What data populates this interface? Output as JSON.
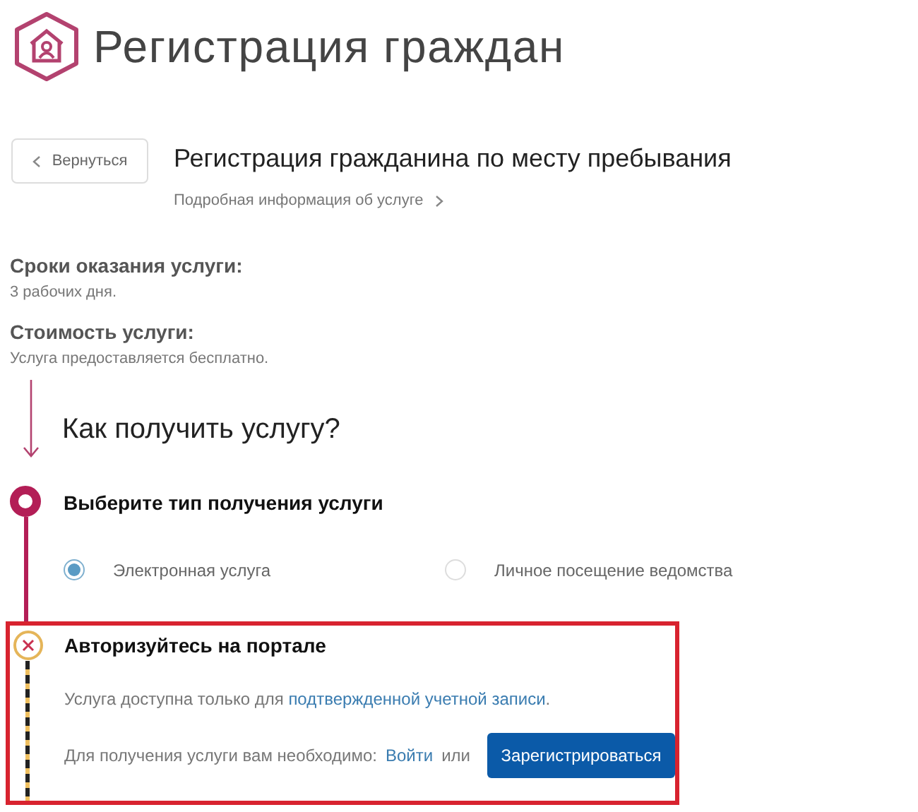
{
  "page_title": "Регистрация граждан",
  "back_button": "Вернуться",
  "service": {
    "title": "Регистрация гражданина по месту пребывания",
    "details_link": "Подробная информация об услуге"
  },
  "info": [
    {
      "label": "Сроки оказания услуги:",
      "value": "3 рабочих дня."
    },
    {
      "label": "Стоимость услуги:",
      "value": "Услуга предоставляется бесплатно."
    }
  ],
  "how_title": "Как получить услугу?",
  "step_choose": {
    "title": "Выберите тип получения услуги",
    "options": [
      {
        "label": "Электронная услуга",
        "selected": true
      },
      {
        "label": "Личное посещение ведомства",
        "selected": false
      }
    ]
  },
  "step_auth": {
    "title": "Авторизуйтесь на портале",
    "highlighted": true,
    "notice": {
      "text": "Услуга доступна только для ",
      "link": "подтвержденной учетной записи",
      "suffix": "."
    },
    "prompt": "Для получения услуги вам необходимо:",
    "login_link": "Войти",
    "or": "или",
    "register_button": "Зарегистрироваться"
  }
}
